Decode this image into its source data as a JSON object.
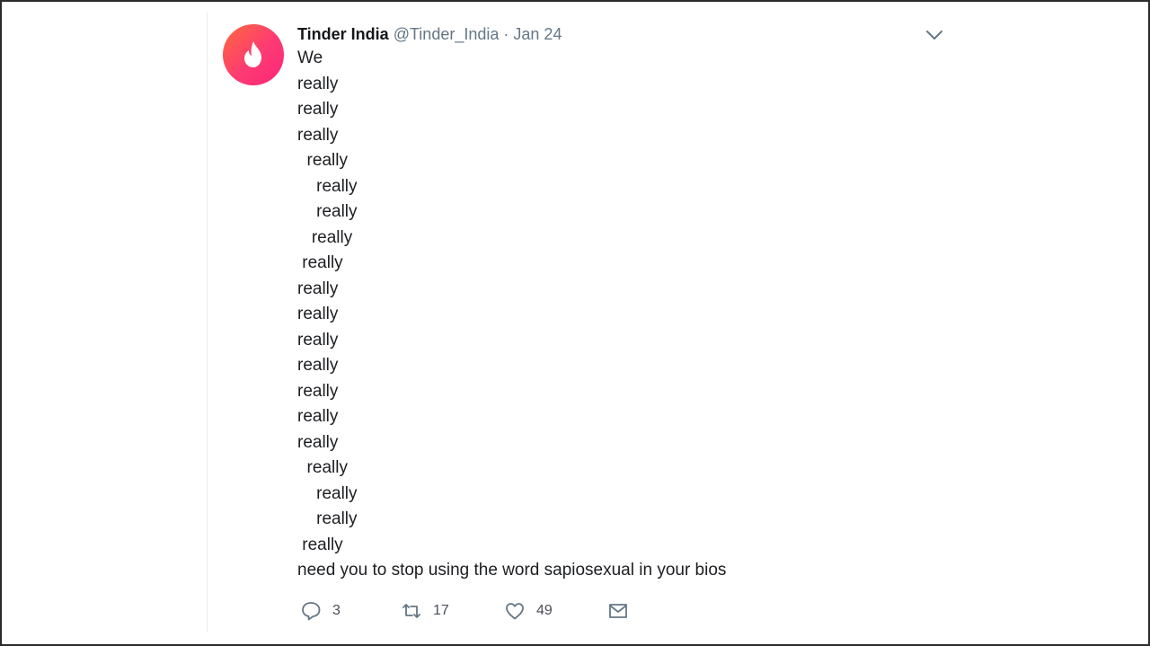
{
  "tweet": {
    "author_name": "Tinder India",
    "handle": "@Tinder_India",
    "separator": "·",
    "date": "Jan 24",
    "avatar_icon": "tinder-flame-icon",
    "accent_color": "#fd3a73",
    "lines": [
      "We",
      "really",
      "really",
      "really",
      "  really",
      "    really",
      "    really",
      "   really",
      " really",
      "really",
      "really",
      "really",
      "really",
      "really",
      "really",
      "really",
      "  really",
      "    really",
      "    really",
      " really",
      "need you to stop using the word sapiosexual in your bios"
    ],
    "actions": {
      "reply": {
        "icon": "reply-icon",
        "count": "3"
      },
      "retweet": {
        "icon": "retweet-icon",
        "count": "17"
      },
      "like": {
        "icon": "heart-icon",
        "count": "49"
      },
      "dm": {
        "icon": "envelope-icon"
      }
    }
  }
}
